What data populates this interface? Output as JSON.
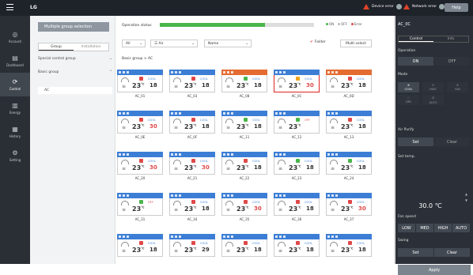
{
  "app": {
    "logo": "LG"
  },
  "alarms": {
    "device_error": "Device error",
    "network_error": "Network error",
    "help": "Help"
  },
  "nav": [
    {
      "label": "Account",
      "icon": "account-icon"
    },
    {
      "label": "Dashboard",
      "icon": "dashboard-icon"
    },
    {
      "label": "Control",
      "icon": "control-icon"
    },
    {
      "label": "Energy",
      "icon": "energy-icon"
    },
    {
      "label": "History",
      "icon": "history-icon"
    },
    {
      "label": "Setting",
      "icon": "setting-icon"
    }
  ],
  "sidepanel": {
    "title": "Multiple group selection",
    "tabs": [
      "Group",
      "Installation"
    ],
    "rows": [
      "Special control group",
      "Basic group",
      "AC"
    ]
  },
  "status": {
    "label": "Operation status",
    "fill_pct": 0.68,
    "legend": [
      "ON",
      "OFF",
      "Error"
    ]
  },
  "filters": {
    "all": "All",
    "type": "Air",
    "name": "Name",
    "checkbox": "Folder",
    "multi": "Multi select"
  },
  "breadcrumb": "Basic group > AC",
  "cards": [
    {
      "name": "AC_01",
      "temp": "23",
      "set": "18",
      "mode": "COOL",
      "pw": "r",
      "hdr": "blue"
    },
    {
      "name": "AC_03",
      "temp": "23",
      "set": "18",
      "mode": "COOL",
      "pw": "r",
      "hdr": "blue"
    },
    {
      "name": "AC_08",
      "temp": "23",
      "set": "18",
      "mode": "COOL",
      "pw": "g",
      "hdr": "orange"
    },
    {
      "name": "AC_0C",
      "temp": "23",
      "set": "30",
      "mode": "COOL",
      "pw": "o",
      "hdr": "blue",
      "sel": true
    },
    {
      "name": "AC_0D",
      "temp": "23",
      "set": "18",
      "mode": "COOL",
      "pw": "r",
      "hdr": "orange"
    },
    {
      "name": "AC_0E",
      "temp": "23",
      "set": "30",
      "mode": "COOL",
      "pw": "r",
      "hdr": "blue"
    },
    {
      "name": "AC_0F",
      "temp": "23",
      "set": "18",
      "mode": "COOL",
      "pw": "r",
      "hdr": "blue"
    },
    {
      "name": "AC_11",
      "temp": "23",
      "set": "18",
      "mode": "COOL",
      "pw": "g",
      "hdr": "blue"
    },
    {
      "name": "AC_12",
      "temp": "23",
      "set": "",
      "mode": "OFF",
      "pw": "g",
      "hdr": "blue"
    },
    {
      "name": "AC_13",
      "temp": "23",
      "set": "18",
      "mode": "COOL",
      "pw": "r",
      "hdr": "blue"
    },
    {
      "name": "AC_20",
      "temp": "23",
      "set": "30",
      "mode": "COOL",
      "pw": "r",
      "hdr": "blue"
    },
    {
      "name": "AC_21",
      "temp": "23",
      "set": "30",
      "mode": "COOL",
      "pw": "r",
      "hdr": "blue"
    },
    {
      "name": "AC_22",
      "temp": "23",
      "set": "18",
      "mode": "COOL",
      "pw": "r",
      "hdr": "blue"
    },
    {
      "name": "AC_23",
      "temp": "23",
      "set": "18",
      "mode": "COOL",
      "pw": "g",
      "hdr": "blue"
    },
    {
      "name": "AC_24",
      "temp": "23",
      "set": "18",
      "mode": "COOL",
      "pw": "g",
      "hdr": "blue"
    },
    {
      "name": "AC_31",
      "temp": "23",
      "set": "",
      "mode": "OFF",
      "pw": "g",
      "hdr": "blue"
    },
    {
      "name": "AC_34",
      "temp": "23",
      "set": "18",
      "mode": "COOL",
      "pw": "r",
      "hdr": "blue"
    },
    {
      "name": "AC_35",
      "temp": "23",
      "set": "30",
      "mode": "COOL",
      "pw": "r",
      "hdr": "blue"
    },
    {
      "name": "AC_36",
      "temp": "23",
      "set": "18",
      "mode": "COOL",
      "pw": "r",
      "hdr": "blue"
    },
    {
      "name": "AC_37",
      "temp": "23",
      "set": "30",
      "mode": "COOL",
      "pw": "r",
      "hdr": "blue"
    },
    {
      "name": "",
      "temp": "23",
      "set": "18",
      "mode": "COOL",
      "pw": "r",
      "hdr": "blue"
    },
    {
      "name": "",
      "temp": "23",
      "set": "29",
      "mode": "COOL",
      "pw": "r",
      "hdr": "blue"
    },
    {
      "name": "",
      "temp": "23",
      "set": "18",
      "mode": "COOL",
      "pw": "r",
      "hdr": "blue"
    },
    {
      "name": "",
      "temp": "23",
      "set": "18",
      "mode": "COOL",
      "pw": "r",
      "hdr": "blue"
    },
    {
      "name": "",
      "temp": "23",
      "set": "18",
      "mode": "COOL",
      "pw": "r",
      "hdr": "blue"
    }
  ],
  "right": {
    "title": "AC_0C",
    "tabs": [
      "Control",
      "Info"
    ],
    "operation": "Operation",
    "on": "ON",
    "off": "OFF",
    "mode_label": "Mode",
    "modes": [
      "COOL",
      "HEAT",
      "FAN",
      "DRY",
      "AUTO"
    ],
    "purify_label": "Air Purify",
    "set": "Set",
    "clear": "Clear",
    "settemp_label": "Set temp.",
    "settemp": "30.0 ℃",
    "fan_label": "Fan speed",
    "fans": [
      "LOW",
      "MED",
      "HIGH",
      "AUTO"
    ],
    "swing_label": "Swing",
    "apply": "Apply"
  }
}
